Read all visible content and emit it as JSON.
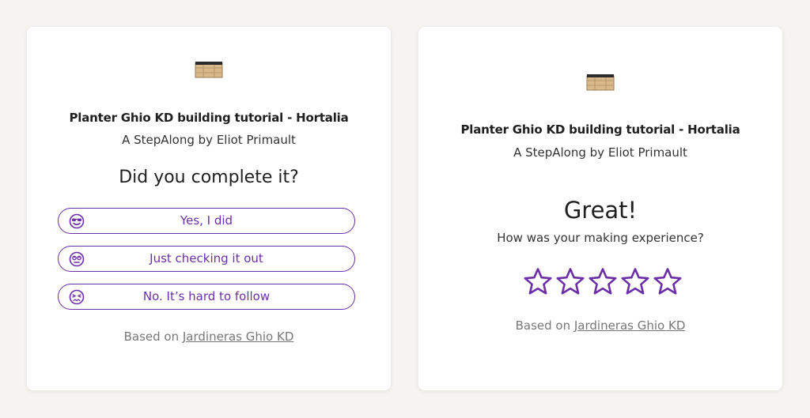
{
  "left_card": {
    "title": "Planter Ghio KD building tutorial - Hortalia",
    "subtitle": "A StepAlong by Eliot Primault",
    "question": "Did you complete it?",
    "options": [
      {
        "label": "Yes, I did",
        "icon": "cool-face-icon"
      },
      {
        "label": "Just checking it out",
        "icon": "eye-roll-face-icon"
      },
      {
        "label": "No. It’s hard to follow",
        "icon": "confounded-face-icon"
      }
    ],
    "based_prefix": "Based on",
    "based_link": "Jardineras Ghio KD"
  },
  "right_card": {
    "title": "Planter Ghio KD building tutorial - Hortalia",
    "subtitle": "A StepAlong by Eliot Primault",
    "heading": "Great!",
    "prompt": "How was your making experience?",
    "rating": {
      "value": 0,
      "max": 5
    },
    "based_prefix": "Based on",
    "based_link": "Jardineras Ghio KD"
  },
  "colors": {
    "accent": "#6b2fa8",
    "background": "#f5f4f1",
    "card": "#ffffff",
    "muted_text": "#777777"
  }
}
